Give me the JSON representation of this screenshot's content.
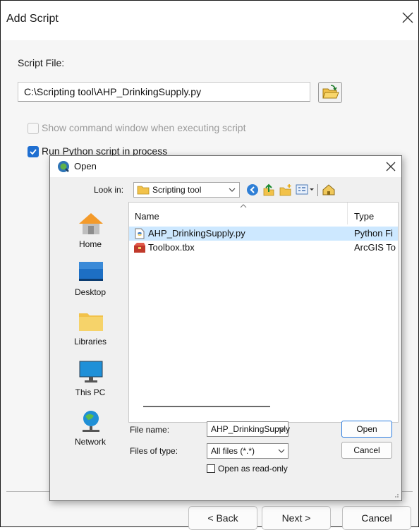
{
  "window": {
    "title": "Add Script"
  },
  "script_file": {
    "label": "Script File:",
    "value": "C:\\Scripting tool\\AHP_DrinkingSupply.py"
  },
  "options": {
    "show_command_window": {
      "label": "Show command window when executing script",
      "checked": false,
      "enabled": false
    },
    "run_in_process": {
      "label": "Run Python script in process",
      "checked": true
    }
  },
  "open_dialog": {
    "title": "Open",
    "look_in_label": "Look in:",
    "look_in_value": "Scripting tool",
    "places": [
      {
        "label": "Home",
        "icon": "home-icon"
      },
      {
        "label": "Desktop",
        "icon": "desktop-icon"
      },
      {
        "label": "Libraries",
        "icon": "libraries-icon"
      },
      {
        "label": "This PC",
        "icon": "this-pc-icon"
      },
      {
        "label": "Network",
        "icon": "network-icon"
      }
    ],
    "columns": {
      "name": "Name",
      "type": "Type"
    },
    "files": [
      {
        "name": "AHP_DrinkingSupply.py",
        "type": "Python Fi",
        "selected": true,
        "icon": "python-file-icon"
      },
      {
        "name": "Toolbox.tbx",
        "type": "ArcGIS To",
        "selected": false,
        "icon": "toolbox-icon"
      }
    ],
    "file_name_label": "File name:",
    "file_name_value": "AHP_DrinkingSupply",
    "files_of_type_label": "Files of type:",
    "files_of_type_value": "All files (*.*)",
    "read_only_label": "Open as read-only",
    "open_button": "Open",
    "cancel_button": "Cancel"
  },
  "footer": {
    "back": "< Back",
    "next": "Next >",
    "cancel": "Cancel"
  },
  "colors": {
    "accent": "#1f6fd1",
    "selection": "#cde8ff"
  }
}
